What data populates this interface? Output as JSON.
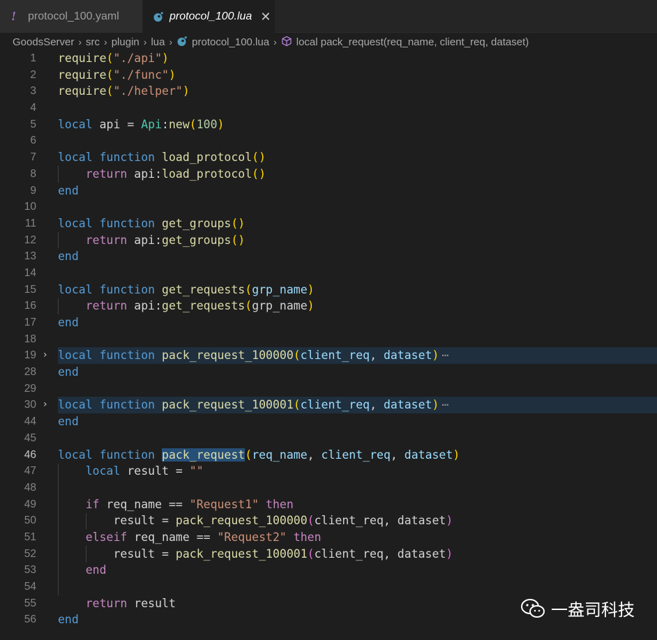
{
  "tabs": [
    {
      "label": "protocol_100.yaml",
      "icon": "yaml-exclamation-icon",
      "active": false
    },
    {
      "label": "protocol_100.lua",
      "icon": "lua-icon",
      "active": true,
      "close": "✕"
    }
  ],
  "breadcrumb": {
    "items": [
      "GoodsServer",
      "src",
      "plugin",
      "lua",
      "protocol_100.lua",
      "local pack_request(req_name, client_req, dataset)"
    ],
    "separator": "›"
  },
  "code_lines": [
    {
      "num": "1",
      "tokens": [
        [
          "fn",
          "require"
        ],
        [
          "brk1",
          "("
        ],
        [
          "str",
          "\"./api\""
        ],
        [
          "brk1",
          ")"
        ]
      ]
    },
    {
      "num": "2",
      "tokens": [
        [
          "fn",
          "require"
        ],
        [
          "brk1",
          "("
        ],
        [
          "str",
          "\"./func\""
        ],
        [
          "brk1",
          ")"
        ]
      ]
    },
    {
      "num": "3",
      "tokens": [
        [
          "fn",
          "require"
        ],
        [
          "brk1",
          "("
        ],
        [
          "str",
          "\"./helper\""
        ],
        [
          "brk1",
          ")"
        ]
      ]
    },
    {
      "num": "4",
      "tokens": []
    },
    {
      "num": "5",
      "tokens": [
        [
          "kw",
          "local"
        ],
        [
          "plain",
          " api = "
        ],
        [
          "cls",
          "Api"
        ],
        [
          "plain",
          ":"
        ],
        [
          "fn",
          "new"
        ],
        [
          "brk1",
          "("
        ],
        [
          "num",
          "100"
        ],
        [
          "brk1",
          ")"
        ]
      ]
    },
    {
      "num": "6",
      "tokens": []
    },
    {
      "num": "7",
      "tokens": [
        [
          "kw",
          "local"
        ],
        [
          "plain",
          " "
        ],
        [
          "kw",
          "function"
        ],
        [
          "plain",
          " "
        ],
        [
          "fn",
          "load_protocol"
        ],
        [
          "brk1",
          "()"
        ]
      ]
    },
    {
      "num": "8",
      "tokens": [
        [
          "plain",
          "    "
        ],
        [
          "ctl",
          "return"
        ],
        [
          "plain",
          " api:"
        ],
        [
          "fn",
          "load_protocol"
        ],
        [
          "brk1",
          "()"
        ]
      ]
    },
    {
      "num": "9",
      "tokens": [
        [
          "kw",
          "end"
        ]
      ]
    },
    {
      "num": "10",
      "tokens": []
    },
    {
      "num": "11",
      "tokens": [
        [
          "kw",
          "local"
        ],
        [
          "plain",
          " "
        ],
        [
          "kw",
          "function"
        ],
        [
          "plain",
          " "
        ],
        [
          "fn",
          "get_groups"
        ],
        [
          "brk1",
          "()"
        ]
      ]
    },
    {
      "num": "12",
      "tokens": [
        [
          "plain",
          "    "
        ],
        [
          "ctl",
          "return"
        ],
        [
          "plain",
          " api:"
        ],
        [
          "fn",
          "get_groups"
        ],
        [
          "brk1",
          "()"
        ]
      ]
    },
    {
      "num": "13",
      "tokens": [
        [
          "kw",
          "end"
        ]
      ]
    },
    {
      "num": "14",
      "tokens": []
    },
    {
      "num": "15",
      "tokens": [
        [
          "kw",
          "local"
        ],
        [
          "plain",
          " "
        ],
        [
          "kw",
          "function"
        ],
        [
          "plain",
          " "
        ],
        [
          "fn",
          "get_requests"
        ],
        [
          "brk1",
          "("
        ],
        [
          "par",
          "grp_name"
        ],
        [
          "brk1",
          ")"
        ]
      ]
    },
    {
      "num": "16",
      "tokens": [
        [
          "plain",
          "    "
        ],
        [
          "ctl",
          "return"
        ],
        [
          "plain",
          " api:"
        ],
        [
          "fn",
          "get_requests"
        ],
        [
          "brk1",
          "("
        ],
        [
          "plain",
          "grp_name"
        ],
        [
          "brk1",
          ")"
        ]
      ]
    },
    {
      "num": "17",
      "tokens": [
        [
          "kw",
          "end"
        ]
      ]
    },
    {
      "num": "18",
      "tokens": []
    },
    {
      "num": "19",
      "folded": true,
      "tokens": [
        [
          "kw",
          "local"
        ],
        [
          "plain",
          " "
        ],
        [
          "kw",
          "function"
        ],
        [
          "plain",
          " "
        ],
        [
          "fn",
          "pack_request_100000"
        ],
        [
          "brk1",
          "("
        ],
        [
          "par",
          "client_req"
        ],
        [
          "plain",
          ", "
        ],
        [
          "par",
          "dataset"
        ],
        [
          "brk1",
          ")"
        ]
      ]
    },
    {
      "num": "28",
      "tokens": [
        [
          "kw",
          "end"
        ]
      ]
    },
    {
      "num": "29",
      "tokens": []
    },
    {
      "num": "30",
      "folded": true,
      "tokens": [
        [
          "kw",
          "local"
        ],
        [
          "plain",
          " "
        ],
        [
          "kw",
          "function"
        ],
        [
          "plain",
          " "
        ],
        [
          "fn",
          "pack_request_100001"
        ],
        [
          "brk1",
          "("
        ],
        [
          "par",
          "client_req"
        ],
        [
          "plain",
          ", "
        ],
        [
          "par",
          "dataset"
        ],
        [
          "brk1",
          ")"
        ]
      ]
    },
    {
      "num": "44",
      "tokens": [
        [
          "kw",
          "end"
        ]
      ]
    },
    {
      "num": "45",
      "tokens": []
    },
    {
      "num": "46",
      "current": true,
      "tokens": [
        [
          "kw",
          "local"
        ],
        [
          "plain",
          " "
        ],
        [
          "kw",
          "function"
        ],
        [
          "plain",
          " "
        ],
        [
          "fnsel",
          "pack_request"
        ],
        [
          "brk1",
          "("
        ],
        [
          "par",
          "req_name"
        ],
        [
          "plain",
          ", "
        ],
        [
          "par",
          "client_req"
        ],
        [
          "plain",
          ", "
        ],
        [
          "par",
          "dataset"
        ],
        [
          "brk1",
          ")"
        ]
      ]
    },
    {
      "num": "47",
      "tokens": [
        [
          "plain",
          "    "
        ],
        [
          "kw",
          "local"
        ],
        [
          "plain",
          " result = "
        ],
        [
          "str",
          "\"\""
        ]
      ]
    },
    {
      "num": "48",
      "tokens": []
    },
    {
      "num": "49",
      "tokens": [
        [
          "plain",
          "    "
        ],
        [
          "ctl",
          "if"
        ],
        [
          "plain",
          " req_name == "
        ],
        [
          "str",
          "\"Request1\""
        ],
        [
          "plain",
          " "
        ],
        [
          "ctl",
          "then"
        ]
      ]
    },
    {
      "num": "50",
      "tokens": [
        [
          "plain",
          "        result = "
        ],
        [
          "fn",
          "pack_request_100000"
        ],
        [
          "brk2",
          "("
        ],
        [
          "plain",
          "client_req, dataset"
        ],
        [
          "brk2",
          ")"
        ]
      ]
    },
    {
      "num": "51",
      "tokens": [
        [
          "plain",
          "    "
        ],
        [
          "ctl",
          "elseif"
        ],
        [
          "plain",
          " req_name == "
        ],
        [
          "str",
          "\"Request2\""
        ],
        [
          "plain",
          " "
        ],
        [
          "ctl",
          "then"
        ]
      ]
    },
    {
      "num": "52",
      "tokens": [
        [
          "plain",
          "        result = "
        ],
        [
          "fn",
          "pack_request_100001"
        ],
        [
          "brk2",
          "("
        ],
        [
          "plain",
          "client_req, dataset"
        ],
        [
          "brk2",
          ")"
        ]
      ]
    },
    {
      "num": "53",
      "tokens": [
        [
          "plain",
          "    "
        ],
        [
          "ctl",
          "end"
        ]
      ]
    },
    {
      "num": "54",
      "tokens": []
    },
    {
      "num": "55",
      "tokens": [
        [
          "plain",
          "    "
        ],
        [
          "ctl",
          "return"
        ],
        [
          "plain",
          " result"
        ]
      ]
    },
    {
      "num": "56",
      "tokens": [
        [
          "kw",
          "end"
        ]
      ]
    }
  ],
  "fold_ellipsis": "⋯",
  "fold_chevron": "›",
  "watermark": {
    "text": "一盎司科技",
    "icon": "wechat-icon"
  }
}
